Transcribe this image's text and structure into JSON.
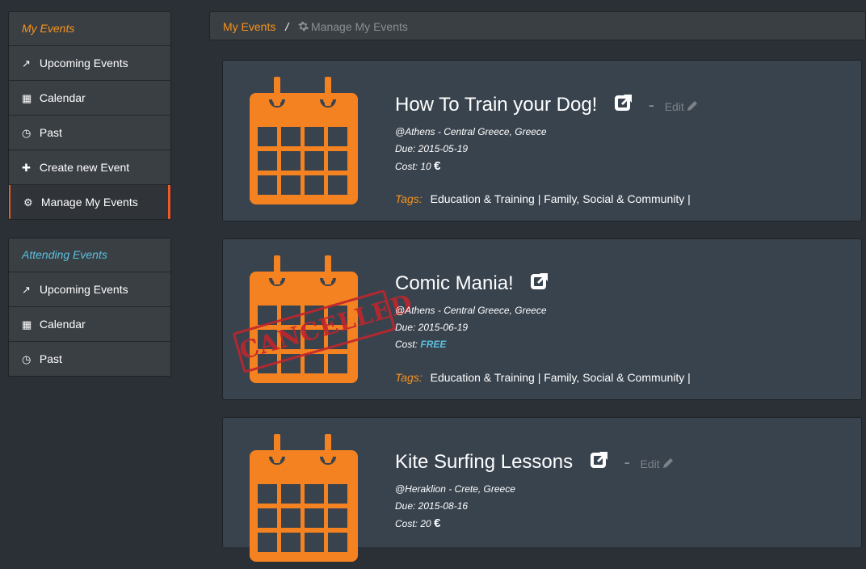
{
  "sidebar": {
    "my_events": {
      "title": "My Events",
      "items": [
        {
          "label": "Upcoming Events",
          "icon": "external-link-icon",
          "glyph": "↗"
        },
        {
          "label": "Calendar",
          "icon": "calendar-icon",
          "glyph": "▦"
        },
        {
          "label": "Past",
          "icon": "clock-icon",
          "glyph": "◷"
        },
        {
          "label": "Create new Event",
          "icon": "plus-icon",
          "glyph": "✚"
        },
        {
          "label": "Manage My Events",
          "icon": "gear-icon",
          "glyph": "⚙"
        }
      ]
    },
    "attending_events": {
      "title": "Attending Events",
      "items": [
        {
          "label": "Upcoming Events",
          "icon": "external-link-icon",
          "glyph": "↗"
        },
        {
          "label": "Calendar",
          "icon": "calendar-icon",
          "glyph": "▦"
        },
        {
          "label": "Past",
          "icon": "clock-icon",
          "glyph": "◷"
        }
      ]
    }
  },
  "breadcrumb": {
    "root": "My Events",
    "separator": "/",
    "current": "Manage My Events"
  },
  "events": [
    {
      "title": "How To Train your Dog!",
      "edit_label": "Edit",
      "location": "@Athens - Central Greece, Greece",
      "due": "Due: 2015-05-19",
      "cost_label": "Cost:",
      "cost": "10",
      "tags_label": "Tags:",
      "tags": "Education & Training | Family, Social & Community |"
    },
    {
      "title": "Comic Mania!",
      "stamp": "CANCELLED",
      "location": "@Athens - Central Greece, Greece",
      "due": "Due: 2015-06-19",
      "cost_label": "Cost:",
      "cost": "FREE",
      "tags_label": "Tags:",
      "tags": "Education & Training | Family, Social & Community |"
    },
    {
      "title": "Kite Surfing Lessons",
      "edit_label": "Edit",
      "location": "@Heraklion - Crete, Greece",
      "due": "Due: 2015-08-16",
      "cost_label": "Cost:",
      "cost": "20"
    }
  ],
  "colors": {
    "accent": "#f7941d",
    "active_border": "#f05a28",
    "free": "#5bc0de",
    "stamp": "#c0262d"
  }
}
